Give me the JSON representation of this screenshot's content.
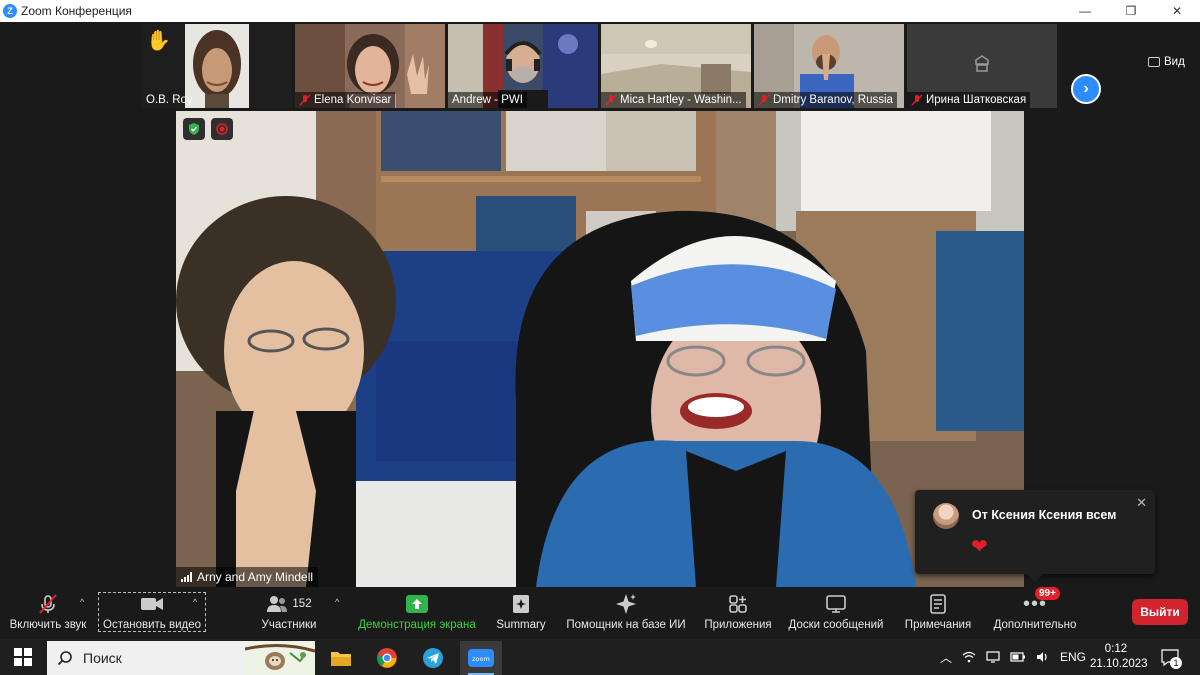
{
  "window": {
    "title": "Zoom Конференция",
    "controls": [
      "—",
      "❐",
      "✕"
    ]
  },
  "strip": {
    "participants": [
      {
        "name": "O.B. Roy",
        "muted": false,
        "hand_raised": true
      },
      {
        "name": "Elena Konvisar",
        "muted": true
      },
      {
        "name": "Andrew - PWI",
        "muted": false
      },
      {
        "name": "Mica Hartley - Washin...",
        "muted": true
      },
      {
        "name": "Dmitry Baranov, Russia",
        "muted": true
      },
      {
        "name": "Ирина Шатковская",
        "muted": true
      }
    ],
    "view_label": "Вид"
  },
  "main": {
    "speaker_name": "Arny and Amy Mindell"
  },
  "toast": {
    "from": "От Ксения Ксения всем",
    "message": "❤"
  },
  "toolbar": {
    "unmute_label": "Включить звук",
    "stop_video_label": "Остановить видео",
    "participants_count": "152",
    "participants_label": "Участники",
    "share_label": "Демонстрация экрана",
    "summary_label": "Summary",
    "ai_label": "Помощник на базе ИИ",
    "apps_label": "Приложения",
    "whiteboards_label": "Доски сообщений",
    "notes_label": "Примечания",
    "more_label": "Дополнительно",
    "more_badge": "99+",
    "leave_label": "Выйти"
  },
  "taskbar": {
    "search_label": "Поиск",
    "lang": "ENG",
    "time": "0:12",
    "date": "21.10.2023",
    "notifications": "1"
  },
  "colors": {
    "accent": "#2d8cff",
    "share_green": "#3cd13c",
    "leave_red": "#d1242f"
  }
}
